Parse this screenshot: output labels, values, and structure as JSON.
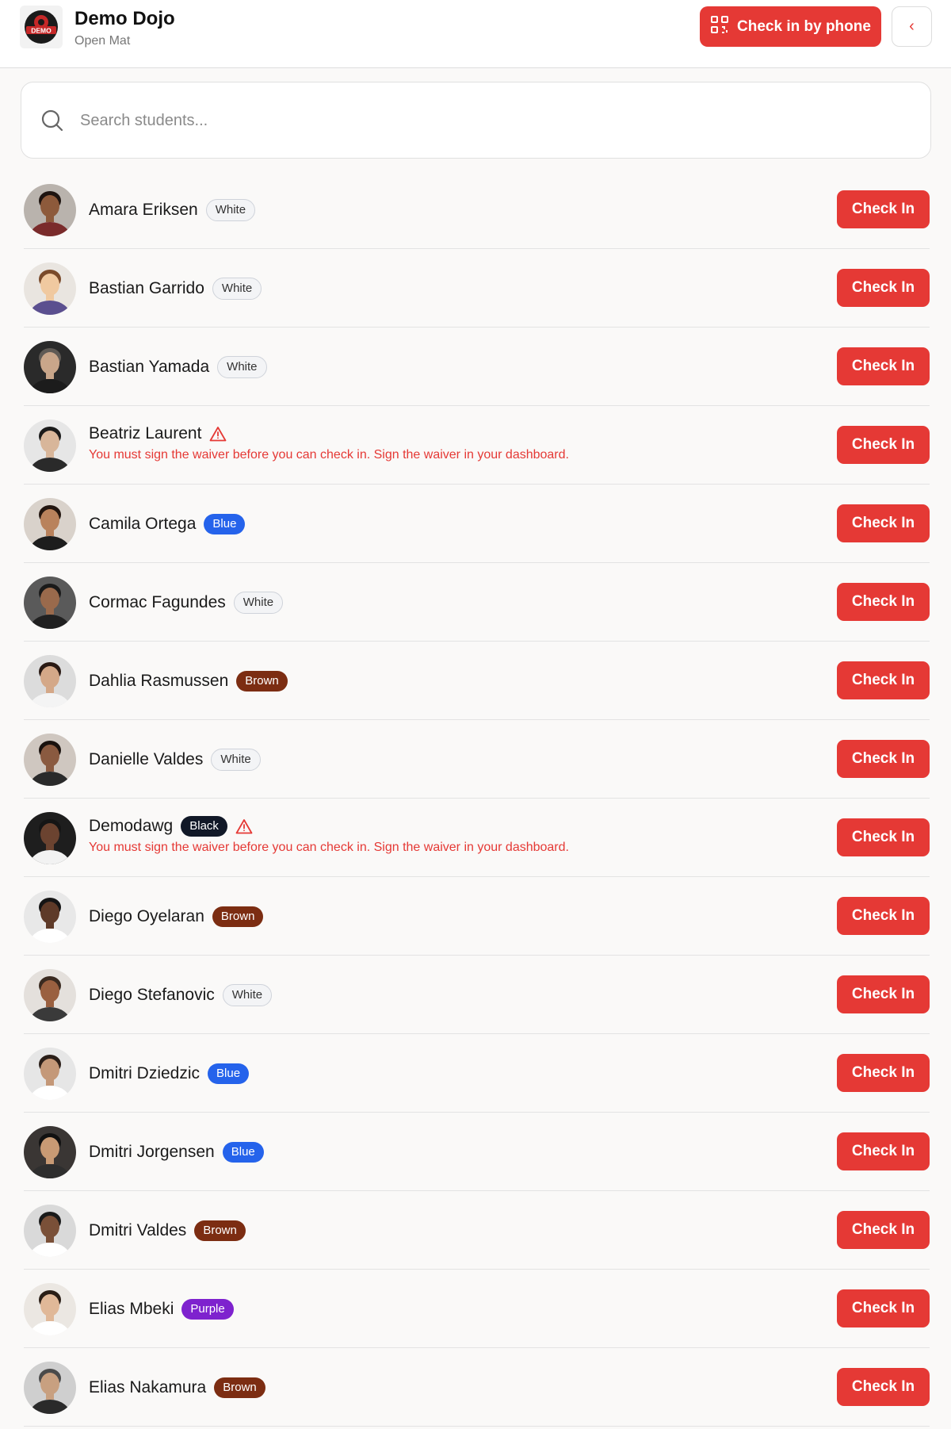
{
  "header": {
    "dojo_name": "Demo Dojo",
    "session": "Open Mat",
    "logo_text": "DEMO",
    "phone_checkin_label": "Check in by phone",
    "back_label": "‹"
  },
  "search": {
    "placeholder": "Search students..."
  },
  "colors": {
    "accent": "#e53935",
    "belt_white": "#f3f4f6",
    "belt_blue": "#2563eb",
    "belt_brown": "#7c2d12",
    "belt_black": "#111827",
    "belt_purple": "#7e22ce"
  },
  "students": [
    {
      "name": "Amara Eriksen",
      "belt": "White",
      "belt_key": "white",
      "warning": "",
      "skin": "#8d5a3b",
      "hair": "#1e1410",
      "bg": "#b9b3ad",
      "shirt": "#7a2b2b",
      "checkin_label": "Check In"
    },
    {
      "name": "Bastian Garrido",
      "belt": "White",
      "belt_key": "white",
      "warning": "",
      "skin": "#f0c9a0",
      "hair": "#7a4a2a",
      "bg": "#e9e5e0",
      "shirt": "#5b4f8f",
      "checkin_label": "Check In"
    },
    {
      "name": "Bastian Yamada",
      "belt": "White",
      "belt_key": "white",
      "warning": "",
      "skin": "#c9a68a",
      "hair": "#5f5a55",
      "bg": "#2a2a2a",
      "shirt": "#1c1c1c",
      "checkin_label": "Check In"
    },
    {
      "name": "Beatriz Laurent",
      "belt": "",
      "belt_key": "",
      "warning": "You must sign the waiver before you can check in. Sign the waiver in your dashboard.",
      "skin": "#d8b69a",
      "hair": "#1a1a1a",
      "bg": "#e6e6e6",
      "shirt": "#2a2a2a",
      "checkin_label": "Check In"
    },
    {
      "name": "Camila Ortega",
      "belt": "Blue",
      "belt_key": "blue",
      "warning": "",
      "skin": "#b9825c",
      "hair": "#22150f",
      "bg": "#d9d2cb",
      "shirt": "#1d1d1d",
      "checkin_label": "Check In"
    },
    {
      "name": "Cormac Fagundes",
      "belt": "White",
      "belt_key": "white",
      "warning": "",
      "skin": "#9a6a4c",
      "hair": "#1a1a1a",
      "bg": "#5a5a5a",
      "shirt": "#202020",
      "checkin_label": "Check In"
    },
    {
      "name": "Dahlia Rasmussen",
      "belt": "Brown",
      "belt_key": "brown",
      "warning": "",
      "skin": "#d4a888",
      "hair": "#2a1a14",
      "bg": "#dcdcdc",
      "shirt": "#f4f4f4",
      "checkin_label": "Check In"
    },
    {
      "name": "Danielle Valdes",
      "belt": "White",
      "belt_key": "white",
      "warning": "",
      "skin": "#8a5a40",
      "hair": "#1a120e",
      "bg": "#cfc7c0",
      "shirt": "#2a2a2a",
      "checkin_label": "Check In"
    },
    {
      "name": "Demodawg",
      "belt": "Black",
      "belt_key": "black",
      "warning": "You must sign the waiver before you can check in. Sign the waiver in your dashboard.",
      "skin": "#6b4330",
      "hair": "#151515",
      "bg": "#1e1e1e",
      "shirt": "#f2f2f2",
      "checkin_label": "Check In"
    },
    {
      "name": "Diego Oyelaran",
      "belt": "Brown",
      "belt_key": "brown",
      "warning": "",
      "skin": "#5e3a28",
      "hair": "#151515",
      "bg": "#e8e8e8",
      "shirt": "#ffffff",
      "checkin_label": "Check In"
    },
    {
      "name": "Diego Stefanovic",
      "belt": "White",
      "belt_key": "white",
      "warning": "",
      "skin": "#9a6040",
      "hair": "#3a2a20",
      "bg": "#e4e0dc",
      "shirt": "#3a3a3a",
      "checkin_label": "Check In"
    },
    {
      "name": "Dmitri Dziedzic",
      "belt": "Blue",
      "belt_key": "blue",
      "warning": "",
      "skin": "#c49878",
      "hair": "#2a1e18",
      "bg": "#e6e6e6",
      "shirt": "#ffffff",
      "checkin_label": "Check In"
    },
    {
      "name": "Dmitri Jorgensen",
      "belt": "Blue",
      "belt_key": "blue",
      "warning": "",
      "skin": "#c89a74",
      "hair": "#111111",
      "bg": "#3a3634",
      "shirt": "#2e2e2e",
      "checkin_label": "Check In"
    },
    {
      "name": "Dmitri Valdes",
      "belt": "Brown",
      "belt_key": "brown",
      "warning": "",
      "skin": "#7a5038",
      "hair": "#1a1a1a",
      "bg": "#d9d9d9",
      "shirt": "#ffffff",
      "checkin_label": "Check In"
    },
    {
      "name": "Elias Mbeki",
      "belt": "Purple",
      "belt_key": "purple",
      "warning": "",
      "skin": "#e0b898",
      "hair": "#2a1e16",
      "bg": "#ebe7e2",
      "shirt": "#ffffff",
      "checkin_label": "Check In"
    },
    {
      "name": "Elias Nakamura",
      "belt": "Brown",
      "belt_key": "brown",
      "warning": "",
      "skin": "#c8a080",
      "hair": "#4a4a4a",
      "bg": "#cfcfcf",
      "shirt": "#2a2a2a",
      "checkin_label": "Check In"
    }
  ]
}
